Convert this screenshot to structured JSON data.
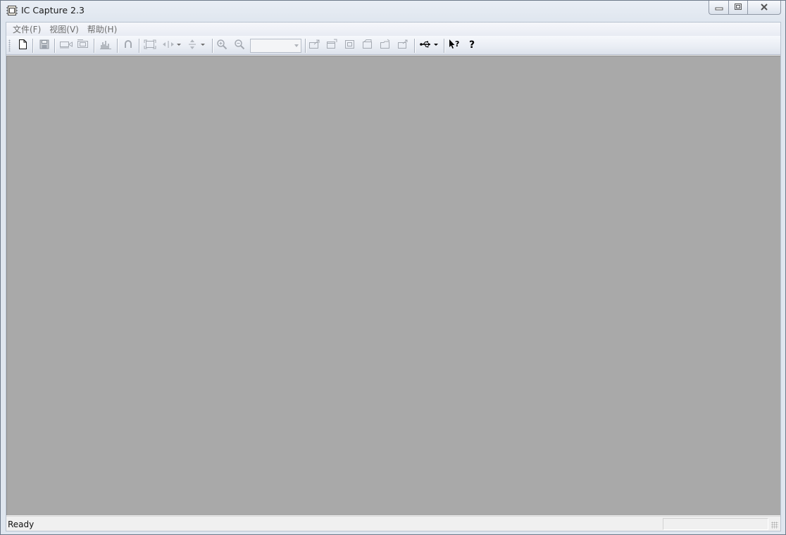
{
  "window": {
    "title": "IC Capture 2.3",
    "icon": "app-frame-icon"
  },
  "caption": {
    "minimize_icon": "minimize-icon",
    "restore_icon": "restore-icon",
    "close_icon": "close-icon"
  },
  "menu": {
    "items": [
      {
        "label": "文件(F)"
      },
      {
        "label": "视图(V)"
      },
      {
        "label": "帮助(H)"
      }
    ]
  },
  "toolbar": {
    "buttons": [
      {
        "name": "new-document-icon",
        "enabled": true
      },
      {
        "name": "save-icon",
        "enabled": false
      },
      {
        "name": "capture-video-icon",
        "enabled": false
      },
      {
        "name": "capture-image-icon",
        "enabled": false
      },
      {
        "name": "histogram-icon",
        "enabled": false
      },
      {
        "name": "undo-icon",
        "enabled": false
      },
      {
        "name": "fit-frame-icon",
        "enabled": false
      },
      {
        "name": "flip-horizontal-icon",
        "enabled": false
      },
      {
        "name": "flip-vertical-icon",
        "enabled": false
      },
      {
        "name": "zoom-in-icon",
        "enabled": false
      },
      {
        "name": "zoom-out-icon",
        "enabled": false
      },
      {
        "name": "export-icon",
        "enabled": false
      },
      {
        "name": "open-window-icon",
        "enabled": false
      },
      {
        "name": "frame-icon",
        "enabled": false
      },
      {
        "name": "properties-icon",
        "enabled": false
      },
      {
        "name": "open-folder-icon",
        "enabled": false
      },
      {
        "name": "share-icon",
        "enabled": false
      },
      {
        "name": "usb-device-icon",
        "enabled": true
      },
      {
        "name": "context-help-icon",
        "enabled": true
      },
      {
        "name": "help-icon",
        "enabled": true
      }
    ],
    "zoom_value": ""
  },
  "status": {
    "text": "Ready"
  },
  "colors": {
    "viewport": "#a9a9a9",
    "menu_text": "#6d6d6d",
    "disabled_icon": "#a4a9b1",
    "enabled_icon": "#000000"
  }
}
